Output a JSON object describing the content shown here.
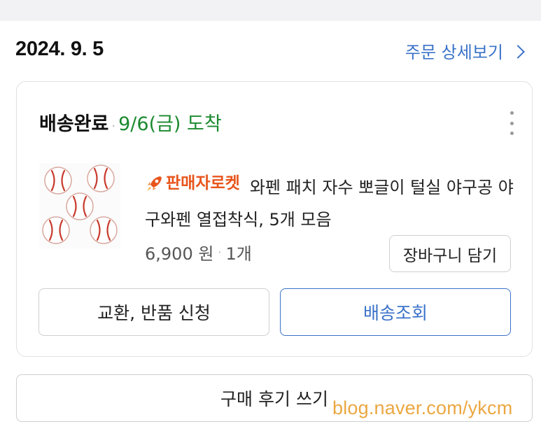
{
  "order": {
    "date": "2024. 9. 5",
    "detail_link_label": "주문 상세보기"
  },
  "shipment": {
    "status": "배송완료",
    "separator": "·",
    "arrival": "9/6(금) 도착"
  },
  "product": {
    "badge_label": "판매자로켓",
    "badge_icon": "rocket-icon",
    "title": "와펜 패치 자수 뽀글이 털실 야구공 야구와펜 열접착식, 5개 모음",
    "price": "6,900 원",
    "price_separator": "·",
    "quantity": "1개",
    "thumbnail_icon": "baseball-patch-image"
  },
  "actions": {
    "add_to_cart": "장바구니 담기",
    "exchange_return": "교환, 반품 신청",
    "track_delivery": "배송조회",
    "write_review": "구매 후기 쓰기"
  },
  "watermark": "blog.naver.com/ykcm",
  "colors": {
    "link_blue": "#3a72c9",
    "arrival_green": "#1b8a2f",
    "badge_orange": "#e8551c",
    "watermark_orange": "#e9a032"
  }
}
